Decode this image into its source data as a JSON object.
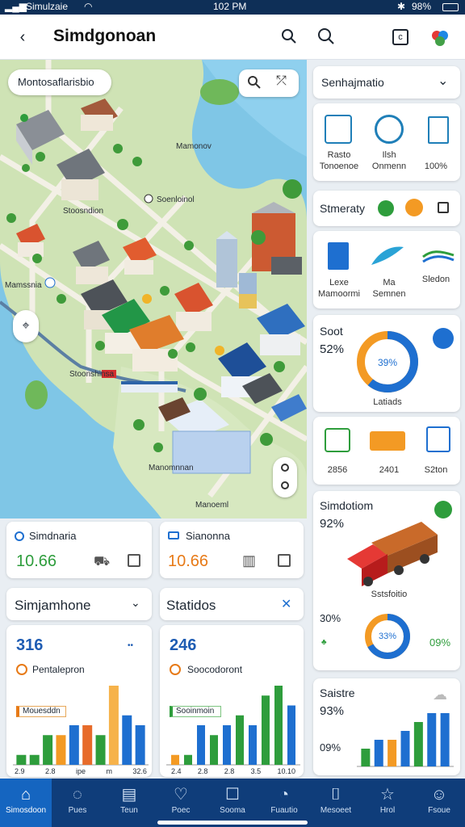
{
  "status": {
    "carrier": "Simulzaie",
    "time": "102 PM",
    "battery": "98%"
  },
  "header": {
    "title": "Simdgonoan"
  },
  "map": {
    "search_text": "Montosaflarisbio",
    "labels": [
      "Mamonov",
      "Stoosndion",
      "Soenloinol",
      "Mamssnia",
      "Stoonshinsa",
      "Manomnnan",
      "Manoeml"
    ]
  },
  "stat_cards": [
    {
      "title": "Simdnaria",
      "value": "10.66",
      "color": "#2e9d3c"
    },
    {
      "title": "Sianonna",
      "value": "10.66",
      "color": "#e77a17"
    }
  ],
  "panels": [
    {
      "title": "Simjamhone",
      "value": "316",
      "sub": "Pentalepron",
      "legend": "Mouesddn",
      "ticks": [
        "2.9",
        "2.8",
        "ipe",
        "m",
        "32.6"
      ],
      "bars": [
        1,
        1,
        3,
        3,
        4,
        4,
        3,
        8,
        5,
        4
      ]
    },
    {
      "title": "Statidos",
      "value": "246",
      "sub": "Soocodoront",
      "legend": "Sooinmoin",
      "ticks": [
        "2.4",
        "2.8",
        "2.8",
        "3.5",
        "10.10"
      ],
      "bars": [
        1,
        1,
        4,
        3,
        4,
        5,
        4,
        7,
        8,
        6
      ]
    }
  ],
  "right": {
    "sec1": {
      "title": "Senhajmatio",
      "items": [
        {
          "top": "Rasto",
          "bottom": "Tonoenoe"
        },
        {
          "top": "Ilsh",
          "bottom": "Onmenn"
        },
        {
          "top": "",
          "bottom": "100%"
        }
      ]
    },
    "sec2": {
      "title": "Stmeraty",
      "items": [
        {
          "top": "Lexe",
          "bottom": "Mamoormi"
        },
        {
          "top": "Ma",
          "bottom": "Semnen"
        },
        {
          "top": "Sledon",
          "bottom": ""
        }
      ]
    },
    "sec3": {
      "title": "Soot",
      "pct": "52%",
      "donut_label": "39%",
      "donut_pct": 0.39,
      "caption": "Latiads",
      "values": [
        "2856",
        "2401",
        "S2ton"
      ]
    },
    "sec4": {
      "title": "Simdotiom",
      "pct": "92%",
      "caption": "Sstsfoitio",
      "pct2": "30%",
      "donut_label": "33%",
      "donut_pct": 0.33,
      "val2": "09%"
    },
    "sec5": {
      "title": "Saistre",
      "pct": "93%",
      "pct2": "09%",
      "bars": [
        2,
        3,
        3,
        4,
        5,
        6,
        6
      ]
    }
  },
  "nav": [
    {
      "label": "Simosdoon",
      "icon": "⌂"
    },
    {
      "label": "Pues",
      "icon": "◌"
    },
    {
      "label": "Teun",
      "icon": "▤"
    },
    {
      "label": "Poec",
      "icon": "♡"
    },
    {
      "label": "Sooma",
      "icon": "☐"
    },
    {
      "label": "Fuautio",
      "icon": "◔"
    },
    {
      "label": "Mesoeet",
      "icon": "⌷"
    },
    {
      "label": "Hrol",
      "icon": "☆"
    },
    {
      "label": "Fsoue",
      "icon": "☺"
    }
  ]
}
